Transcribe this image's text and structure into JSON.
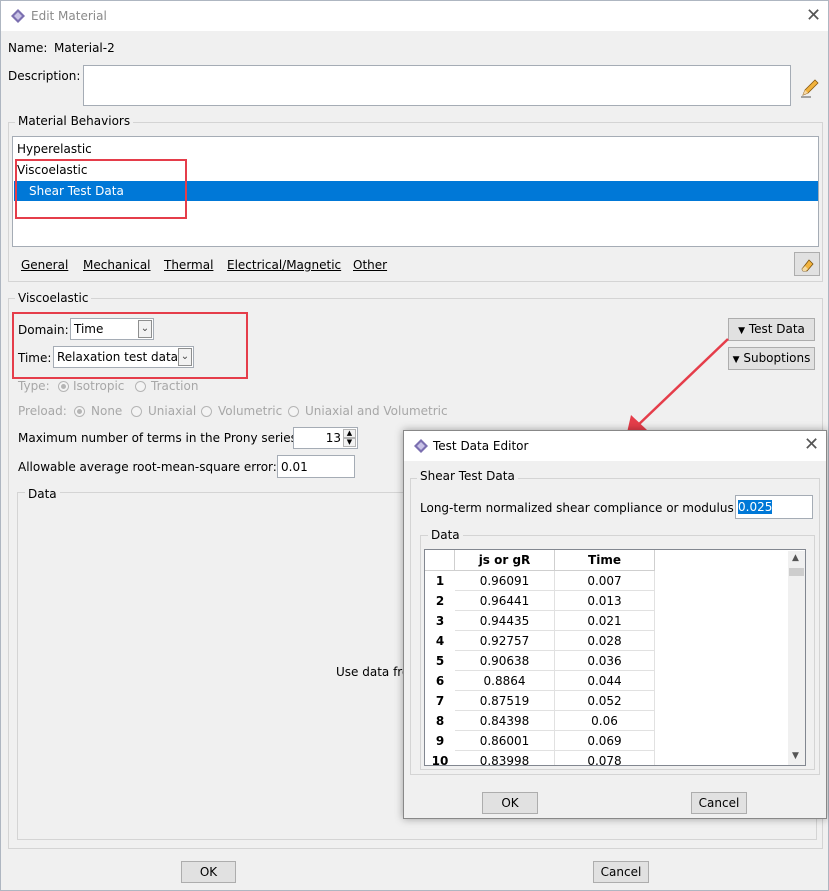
{
  "window": {
    "title": "Edit Material",
    "name_label": "Name:",
    "name_value": "Material-2",
    "description_label": "Description:",
    "description_value": ""
  },
  "behaviors": {
    "group_title": "Material Behaviors",
    "items": [
      "Hyperelastic",
      "Viscoelastic",
      "Shear Test Data"
    ],
    "selected": "Shear Test Data"
  },
  "menus": [
    "General",
    "Mechanical",
    "Thermal",
    "Electrical/Magnetic",
    "Other"
  ],
  "viscoelastic": {
    "group_title": "Viscoelastic",
    "domain_label": "Domain:",
    "domain_value": "Time",
    "time_label": "Time:",
    "time_value": "Relaxation test data",
    "type_label": "Type:",
    "type_options": [
      "Isotropic",
      "Traction"
    ],
    "preload_label": "Preload:",
    "preload_options": [
      "None",
      "Uniaxial",
      "Volumetric",
      "Uniaxial and Volumetric"
    ],
    "prony_label": "Maximum number of terms in the Prony series:",
    "prony_value": "13",
    "rms_label": "Allowable average root-mean-square error:",
    "rms_value": "0.01",
    "data_group_title": "Data",
    "data_message": "Use data fro",
    "test_data_button": "Test Data",
    "suboptions_button": "Suboptions"
  },
  "bottom_buttons": {
    "ok": "OK",
    "cancel": "Cancel"
  },
  "popup": {
    "title": "Test Data Editor",
    "group_title": "Shear Test Data",
    "longterm_label": "Long-term normalized shear compliance or modulus:",
    "longterm_value": "0.025",
    "data_group_title": "Data",
    "columns": [
      "js or gR",
      "Time"
    ],
    "rows": [
      [
        "1",
        "0.96091",
        "0.007"
      ],
      [
        "2",
        "0.96441",
        "0.013"
      ],
      [
        "3",
        "0.94435",
        "0.021"
      ],
      [
        "4",
        "0.92757",
        "0.028"
      ],
      [
        "5",
        "0.90638",
        "0.036"
      ],
      [
        "6",
        "0.8864",
        "0.044"
      ],
      [
        "7",
        "0.87519",
        "0.052"
      ],
      [
        "8",
        "0.84398",
        "0.06"
      ],
      [
        "9",
        "0.86001",
        "0.069"
      ],
      [
        "10",
        "0.83998",
        "0.078"
      ]
    ],
    "ok": "OK",
    "cancel": "Cancel"
  },
  "colors": {
    "selection": "#0078d7",
    "highlight_box": "#e53d4a",
    "arrow": "#e53d4a"
  },
  "icons": [
    "abaqus-app-icon",
    "close-icon",
    "pencil-icon",
    "eraser-icon",
    "triangle-down-icon",
    "spinner-icon"
  ]
}
